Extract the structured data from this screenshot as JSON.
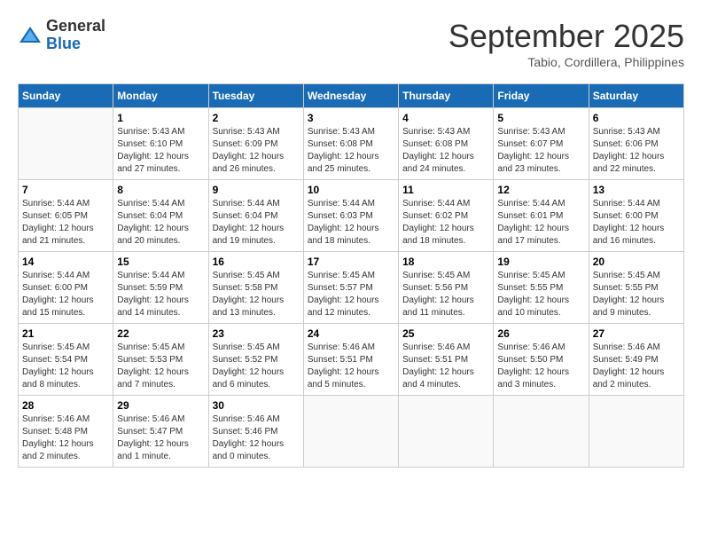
{
  "logo": {
    "general": "General",
    "blue": "Blue"
  },
  "title": "September 2025",
  "subtitle": "Tabio, Cordillera, Philippines",
  "headers": [
    "Sunday",
    "Monday",
    "Tuesday",
    "Wednesday",
    "Thursday",
    "Friday",
    "Saturday"
  ],
  "weeks": [
    [
      {
        "day": "",
        "info": ""
      },
      {
        "day": "1",
        "info": "Sunrise: 5:43 AM\nSunset: 6:10 PM\nDaylight: 12 hours\nand 27 minutes."
      },
      {
        "day": "2",
        "info": "Sunrise: 5:43 AM\nSunset: 6:09 PM\nDaylight: 12 hours\nand 26 minutes."
      },
      {
        "day": "3",
        "info": "Sunrise: 5:43 AM\nSunset: 6:08 PM\nDaylight: 12 hours\nand 25 minutes."
      },
      {
        "day": "4",
        "info": "Sunrise: 5:43 AM\nSunset: 6:08 PM\nDaylight: 12 hours\nand 24 minutes."
      },
      {
        "day": "5",
        "info": "Sunrise: 5:43 AM\nSunset: 6:07 PM\nDaylight: 12 hours\nand 23 minutes."
      },
      {
        "day": "6",
        "info": "Sunrise: 5:43 AM\nSunset: 6:06 PM\nDaylight: 12 hours\nand 22 minutes."
      }
    ],
    [
      {
        "day": "7",
        "info": "Sunrise: 5:44 AM\nSunset: 6:05 PM\nDaylight: 12 hours\nand 21 minutes."
      },
      {
        "day": "8",
        "info": "Sunrise: 5:44 AM\nSunset: 6:04 PM\nDaylight: 12 hours\nand 20 minutes."
      },
      {
        "day": "9",
        "info": "Sunrise: 5:44 AM\nSunset: 6:04 PM\nDaylight: 12 hours\nand 19 minutes."
      },
      {
        "day": "10",
        "info": "Sunrise: 5:44 AM\nSunset: 6:03 PM\nDaylight: 12 hours\nand 18 minutes."
      },
      {
        "day": "11",
        "info": "Sunrise: 5:44 AM\nSunset: 6:02 PM\nDaylight: 12 hours\nand 18 minutes."
      },
      {
        "day": "12",
        "info": "Sunrise: 5:44 AM\nSunset: 6:01 PM\nDaylight: 12 hours\nand 17 minutes."
      },
      {
        "day": "13",
        "info": "Sunrise: 5:44 AM\nSunset: 6:00 PM\nDaylight: 12 hours\nand 16 minutes."
      }
    ],
    [
      {
        "day": "14",
        "info": "Sunrise: 5:44 AM\nSunset: 6:00 PM\nDaylight: 12 hours\nand 15 minutes."
      },
      {
        "day": "15",
        "info": "Sunrise: 5:44 AM\nSunset: 5:59 PM\nDaylight: 12 hours\nand 14 minutes."
      },
      {
        "day": "16",
        "info": "Sunrise: 5:45 AM\nSunset: 5:58 PM\nDaylight: 12 hours\nand 13 minutes."
      },
      {
        "day": "17",
        "info": "Sunrise: 5:45 AM\nSunset: 5:57 PM\nDaylight: 12 hours\nand 12 minutes."
      },
      {
        "day": "18",
        "info": "Sunrise: 5:45 AM\nSunset: 5:56 PM\nDaylight: 12 hours\nand 11 minutes."
      },
      {
        "day": "19",
        "info": "Sunrise: 5:45 AM\nSunset: 5:55 PM\nDaylight: 12 hours\nand 10 minutes."
      },
      {
        "day": "20",
        "info": "Sunrise: 5:45 AM\nSunset: 5:55 PM\nDaylight: 12 hours\nand 9 minutes."
      }
    ],
    [
      {
        "day": "21",
        "info": "Sunrise: 5:45 AM\nSunset: 5:54 PM\nDaylight: 12 hours\nand 8 minutes."
      },
      {
        "day": "22",
        "info": "Sunrise: 5:45 AM\nSunset: 5:53 PM\nDaylight: 12 hours\nand 7 minutes."
      },
      {
        "day": "23",
        "info": "Sunrise: 5:45 AM\nSunset: 5:52 PM\nDaylight: 12 hours\nand 6 minutes."
      },
      {
        "day": "24",
        "info": "Sunrise: 5:46 AM\nSunset: 5:51 PM\nDaylight: 12 hours\nand 5 minutes."
      },
      {
        "day": "25",
        "info": "Sunrise: 5:46 AM\nSunset: 5:51 PM\nDaylight: 12 hours\nand 4 minutes."
      },
      {
        "day": "26",
        "info": "Sunrise: 5:46 AM\nSunset: 5:50 PM\nDaylight: 12 hours\nand 3 minutes."
      },
      {
        "day": "27",
        "info": "Sunrise: 5:46 AM\nSunset: 5:49 PM\nDaylight: 12 hours\nand 2 minutes."
      }
    ],
    [
      {
        "day": "28",
        "info": "Sunrise: 5:46 AM\nSunset: 5:48 PM\nDaylight: 12 hours\nand 2 minutes."
      },
      {
        "day": "29",
        "info": "Sunrise: 5:46 AM\nSunset: 5:47 PM\nDaylight: 12 hours\nand 1 minute."
      },
      {
        "day": "30",
        "info": "Sunrise: 5:46 AM\nSunset: 5:46 PM\nDaylight: 12 hours\nand 0 minutes."
      },
      {
        "day": "",
        "info": ""
      },
      {
        "day": "",
        "info": ""
      },
      {
        "day": "",
        "info": ""
      },
      {
        "day": "",
        "info": ""
      }
    ]
  ]
}
